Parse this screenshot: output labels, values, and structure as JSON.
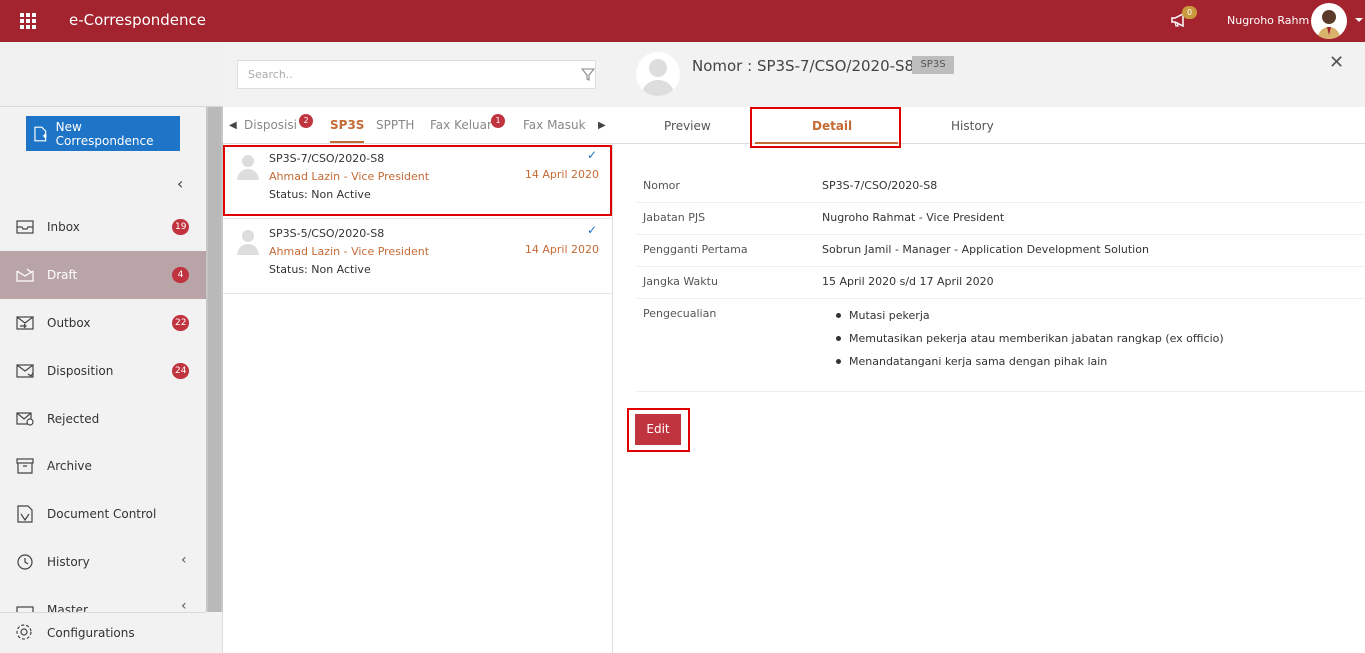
{
  "header": {
    "app_title": "e-Correspondence",
    "notification_count": "0",
    "user_name": "Nugroho Rahm"
  },
  "sidebar": {
    "new_button": "New Correspondence",
    "items": [
      {
        "label": "Inbox",
        "badge": "19",
        "icon": "inbox-icon"
      },
      {
        "label": "Draft",
        "badge": "4",
        "icon": "draft-icon"
      },
      {
        "label": "Outbox",
        "badge": "22",
        "icon": "outbox-icon"
      },
      {
        "label": "Disposition",
        "badge": "24",
        "icon": "disposition-icon"
      },
      {
        "label": "Rejected",
        "badge": "",
        "icon": "rejected-icon"
      },
      {
        "label": "Archive",
        "badge": "",
        "icon": "archive-icon"
      },
      {
        "label": "Document Control",
        "badge": "",
        "icon": "document-control-icon"
      },
      {
        "label": "History",
        "badge": "",
        "icon": "history-icon"
      },
      {
        "label": "Master",
        "badge": "",
        "icon": "master-icon"
      }
    ],
    "config_label": "Configurations"
  },
  "middle": {
    "search_placeholder": "Search..",
    "tabs": [
      {
        "label": "Disposisi",
        "badge": "2"
      },
      {
        "label": "SP3S",
        "badge": ""
      },
      {
        "label": "SPPTH",
        "badge": ""
      },
      {
        "label": "Fax Keluar",
        "badge": "1"
      },
      {
        "label": "Fax Masuk",
        "badge": ""
      }
    ],
    "cards": [
      {
        "number": "SP3S-7/CSO/2020-S8",
        "from": "Ahmad Lazin - Vice President",
        "status": "Status: Non Active",
        "date": "14 April 2020"
      },
      {
        "number": "SP3S-5/CSO/2020-S8",
        "from": "Ahmad Lazin - Vice President",
        "status": "Status: Non Active",
        "date": "14 April 2020"
      }
    ]
  },
  "detail": {
    "title": "Nomor : SP3S-7/CSO/2020-S8",
    "tag": "SP3S",
    "tabs": [
      "Preview",
      "Detail",
      "History"
    ],
    "rows": [
      {
        "label": "Nomor",
        "value": "SP3S-7/CSO/2020-S8"
      },
      {
        "label": "Jabatan PJS",
        "value": "Nugroho Rahmat - Vice President"
      },
      {
        "label": "Pengganti Pertama",
        "value": "Sobrun Jamil - Manager - Application Development Solution"
      },
      {
        "label": "Jangka Waktu",
        "value": "15 April 2020 s/d 17 April 2020"
      }
    ],
    "exception_label": "Pengecualian",
    "exceptions": [
      "Mutasi pekerja",
      "Memutasikan pekerja atau memberikan jabatan rangkap (ex officio)",
      "Menandatangani kerja sama dengan pihak lain"
    ],
    "edit_button": "Edit"
  },
  "colors": {
    "brand": "#a3232f",
    "accent": "#c36a35",
    "primary_button": "#1e74c6",
    "badge": "#c0343f"
  }
}
